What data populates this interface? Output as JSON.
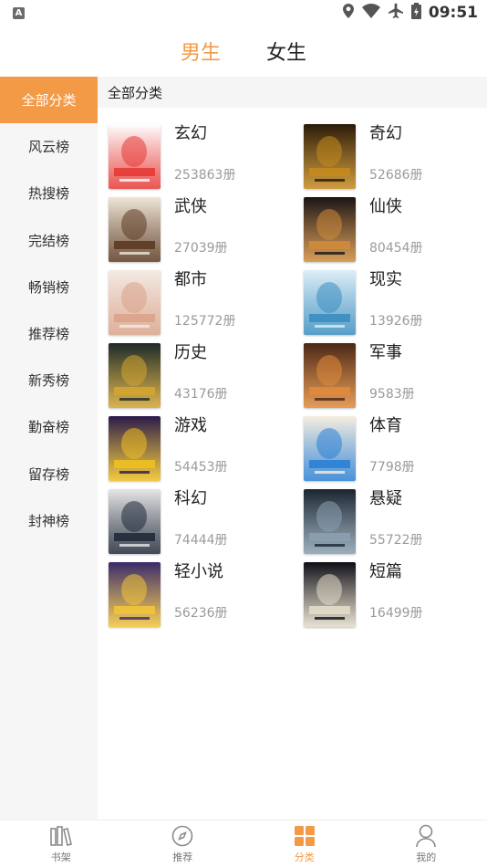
{
  "status_bar": {
    "time": "09:51",
    "app_badge": "A",
    "icons": [
      "location-icon",
      "wifi-icon",
      "airplane-icon",
      "battery-icon"
    ]
  },
  "gender_tabs": [
    {
      "label": "男生",
      "active": true
    },
    {
      "label": "女生",
      "active": false
    }
  ],
  "sidebar": {
    "items": [
      {
        "label": "全部分类",
        "active": true
      },
      {
        "label": "风云榜"
      },
      {
        "label": "热搜榜"
      },
      {
        "label": "完结榜"
      },
      {
        "label": "畅销榜"
      },
      {
        "label": "推荐榜"
      },
      {
        "label": "新秀榜"
      },
      {
        "label": "勤奋榜"
      },
      {
        "label": "留存榜"
      },
      {
        "label": "封神榜"
      }
    ]
  },
  "main": {
    "section_title": "全部分类",
    "categories": [
      {
        "name": "玄幻",
        "count": "253863册",
        "colors": [
          "#ffffff",
          "#e53935"
        ]
      },
      {
        "name": "奇幻",
        "count": "52686册",
        "colors": [
          "#2a1a08",
          "#c58a1e"
        ]
      },
      {
        "name": "武侠",
        "count": "27039册",
        "colors": [
          "#efe6d6",
          "#5c3a22"
        ]
      },
      {
        "name": "仙侠",
        "count": "80454册",
        "colors": [
          "#1a1416",
          "#d08b3a"
        ]
      },
      {
        "name": "都市",
        "count": "125772册",
        "colors": [
          "#f3ebe3",
          "#d9a38a"
        ]
      },
      {
        "name": "现实",
        "count": "13926册",
        "colors": [
          "#dfeef6",
          "#3b8ec0"
        ]
      },
      {
        "name": "历史",
        "count": "43176册",
        "colors": [
          "#1c2a2a",
          "#d4a530"
        ]
      },
      {
        "name": "军事",
        "count": "9583册",
        "colors": [
          "#4a2716",
          "#e08a3a"
        ]
      },
      {
        "name": "游戏",
        "count": "54453册",
        "colors": [
          "#2a1b4a",
          "#f0c020"
        ]
      },
      {
        "name": "体育",
        "count": "7798册",
        "colors": [
          "#f6eede",
          "#2b7fd4"
        ]
      },
      {
        "name": "科幻",
        "count": "74444册",
        "colors": [
          "#e6e6e6",
          "#202a3a"
        ]
      },
      {
        "name": "悬疑",
        "count": "55722册",
        "colors": [
          "#1b2530",
          "#8aa0b0"
        ]
      },
      {
        "name": "轻小说",
        "count": "56236册",
        "colors": [
          "#3a2a6a",
          "#f2c43a"
        ]
      },
      {
        "name": "短篇",
        "count": "16499册",
        "colors": [
          "#0e0e16",
          "#e3dcc8"
        ]
      }
    ]
  },
  "bottom_nav": [
    {
      "label": "书架",
      "icon": "bookshelf-icon",
      "active": false
    },
    {
      "label": "推荐",
      "icon": "compass-icon",
      "active": false
    },
    {
      "label": "分类",
      "icon": "grid-icon",
      "active": true
    },
    {
      "label": "我的",
      "icon": "person-icon",
      "active": false
    }
  ],
  "accent_color": "#f39a46"
}
